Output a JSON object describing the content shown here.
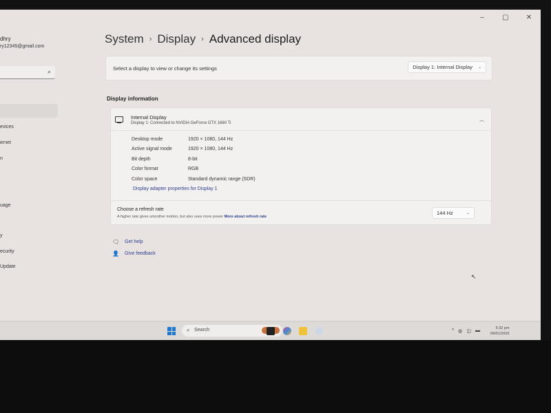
{
  "window": {
    "controls": [
      "minimize",
      "maximize",
      "close"
    ]
  },
  "sidebar": {
    "user_name": "dhry",
    "user_email": "ry12345@gmail.com",
    "search_icon": "search-icon",
    "items": [
      {
        "label": "evices"
      },
      {
        "label": "ernet"
      },
      {
        "label": "n"
      },
      {
        "label": "uage"
      },
      {
        "label": "y"
      },
      {
        "label": "ecurity"
      },
      {
        "label": "Update"
      }
    ]
  },
  "breadcrumb": {
    "items": [
      "System",
      "Display",
      "Advanced display"
    ],
    "separator": "›"
  },
  "display_select": {
    "label": "Select a display to view or change its settings",
    "value": "Display 1: Internal Display"
  },
  "display_info": {
    "section_title": "Display information",
    "display_name": "Internal Display",
    "display_subtitle": "Display 1: Connected to NVIDIA GeForce GTX 1660 Ti",
    "rows": [
      {
        "label": "Desktop mode",
        "value": "1920 × 1080, 144 Hz"
      },
      {
        "label": "Active signal mode",
        "value": "1920 × 1080, 144 Hz"
      },
      {
        "label": "Bit depth",
        "value": "8-bit"
      },
      {
        "label": "Color format",
        "value": "RGB"
      },
      {
        "label": "Color space",
        "value": "Standard dynamic range (SDR)"
      }
    ],
    "adapter_link": "Display adapter properties for Display 1"
  },
  "refresh_rate": {
    "title": "Choose a refresh rate",
    "description": "A higher rate gives smoother motion, but also uses more power",
    "link": "More about refresh rate",
    "value": "144 Hz"
  },
  "help_links": [
    {
      "label": "Get help",
      "icon": "help-icon"
    },
    {
      "label": "Give feedback",
      "icon": "feedback-icon"
    }
  ],
  "taskbar": {
    "search_placeholder": "Search",
    "clock_time": "5:32 pm",
    "clock_date": "09/01/2025"
  }
}
